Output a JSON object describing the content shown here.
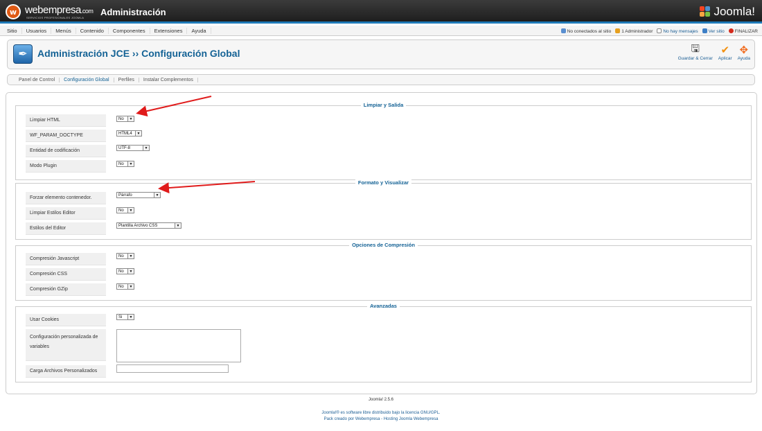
{
  "header": {
    "brand_name": "webempresa",
    "brand_suffix": ".com",
    "brand_tagline": "SERVICIOS PROFESIONALES JOOMLA",
    "admin_title": "Administración",
    "joomla_logo": "Joomla!"
  },
  "menu": [
    "Sitio",
    "Usuarios",
    "Menús",
    "Contenido",
    "Componentes",
    "Extensiones",
    "Ayuda"
  ],
  "status": {
    "visitors": "No conectados al sitio",
    "admins": "1 Administrador",
    "messages": "No hay mensajes",
    "view_site": "Ver sitio",
    "logout": "FINALIZAR"
  },
  "toolbar": {
    "title": "Administración JCE ›› Configuración Global",
    "save_close": "Guardar & Cerrar",
    "apply": "Aplicar",
    "help": "Ayuda"
  },
  "tabs": [
    "Panel de Control",
    "Configuración Global",
    "Perfiles",
    "Instalar Complementos"
  ],
  "groups": {
    "cleanup": {
      "legend": "Limpiar y Salida",
      "fields": [
        {
          "label": "Limpiar HTML",
          "value": "No"
        },
        {
          "label": "WF_PARAM_DOCTYPE",
          "value": "HTML4"
        },
        {
          "label": "Entidad de codificación",
          "value": "UTF-8"
        },
        {
          "label": "Modo Plugin",
          "value": "No"
        }
      ]
    },
    "format": {
      "legend": "Formato y Visualizar",
      "fields": [
        {
          "label": "Forzar elemento contenedor.",
          "value": "Párrafo"
        },
        {
          "label": "Limpiar Estilos Editor",
          "value": "No"
        },
        {
          "label": "Estilos del Editor",
          "value": "Plantilla Archivo CSS"
        }
      ]
    },
    "compression": {
      "legend": "Opciones de Compresión",
      "fields": [
        {
          "label": "Compresión Javascript",
          "value": "No"
        },
        {
          "label": "Compresión CSS",
          "value": "No"
        },
        {
          "label": "Compresión GZip",
          "value": "No"
        }
      ]
    },
    "advanced": {
      "legend": "Avanzadas",
      "cookies_label": "Usar Cookies",
      "cookies_value": "Si",
      "custom_config_label": "Configuración personalizada de variables",
      "custom_config_value": "",
      "custom_files_label": "Carga Archivos Personalizados",
      "custom_files_value": ""
    }
  },
  "footer": {
    "version": "Joomla! 2.5.6",
    "license": "Joomla!® es software libre distribuido bajo la licencia GNU/GPL.",
    "credits": "Pack creado por Webempresa - Hosting Joomla Webempresa"
  },
  "colors": {
    "accent": "#146295",
    "arrow": "#e01b1b",
    "header_bg": "#2b2b2b",
    "header_line": "#1f7ab8"
  }
}
